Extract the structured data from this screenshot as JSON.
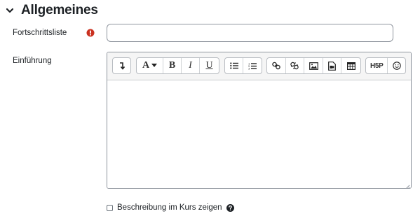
{
  "section": {
    "title": "Allgemeines",
    "icon": "chevron-down-icon"
  },
  "fields": {
    "name": {
      "label": "Fortschrittsliste",
      "required_icon": "exclamation-circle-icon",
      "required_color": "#ca3120",
      "value": "",
      "placeholder": ""
    },
    "intro": {
      "label": "Einführung",
      "content": ""
    }
  },
  "toolbar": {
    "groups": [
      [
        "collapse-icon"
      ],
      [
        "text-style-dropdown",
        "bold-button",
        "italic-button",
        "underline-button"
      ],
      [
        "unordered-list-icon",
        "ordered-list-icon"
      ],
      [
        "link-icon",
        "unlink-icon",
        "image-icon",
        "media-icon",
        "table-icon"
      ],
      [
        "h5p-icon",
        "emoji-icon"
      ]
    ],
    "style_label": "A",
    "bold_label": "B",
    "italic_label": "I",
    "underline_label": "U",
    "h5p_label": "H5P"
  },
  "show_description": {
    "label": "Beschreibung im Kurs zeigen",
    "checked": false,
    "help_icon": "question-circle-icon"
  }
}
